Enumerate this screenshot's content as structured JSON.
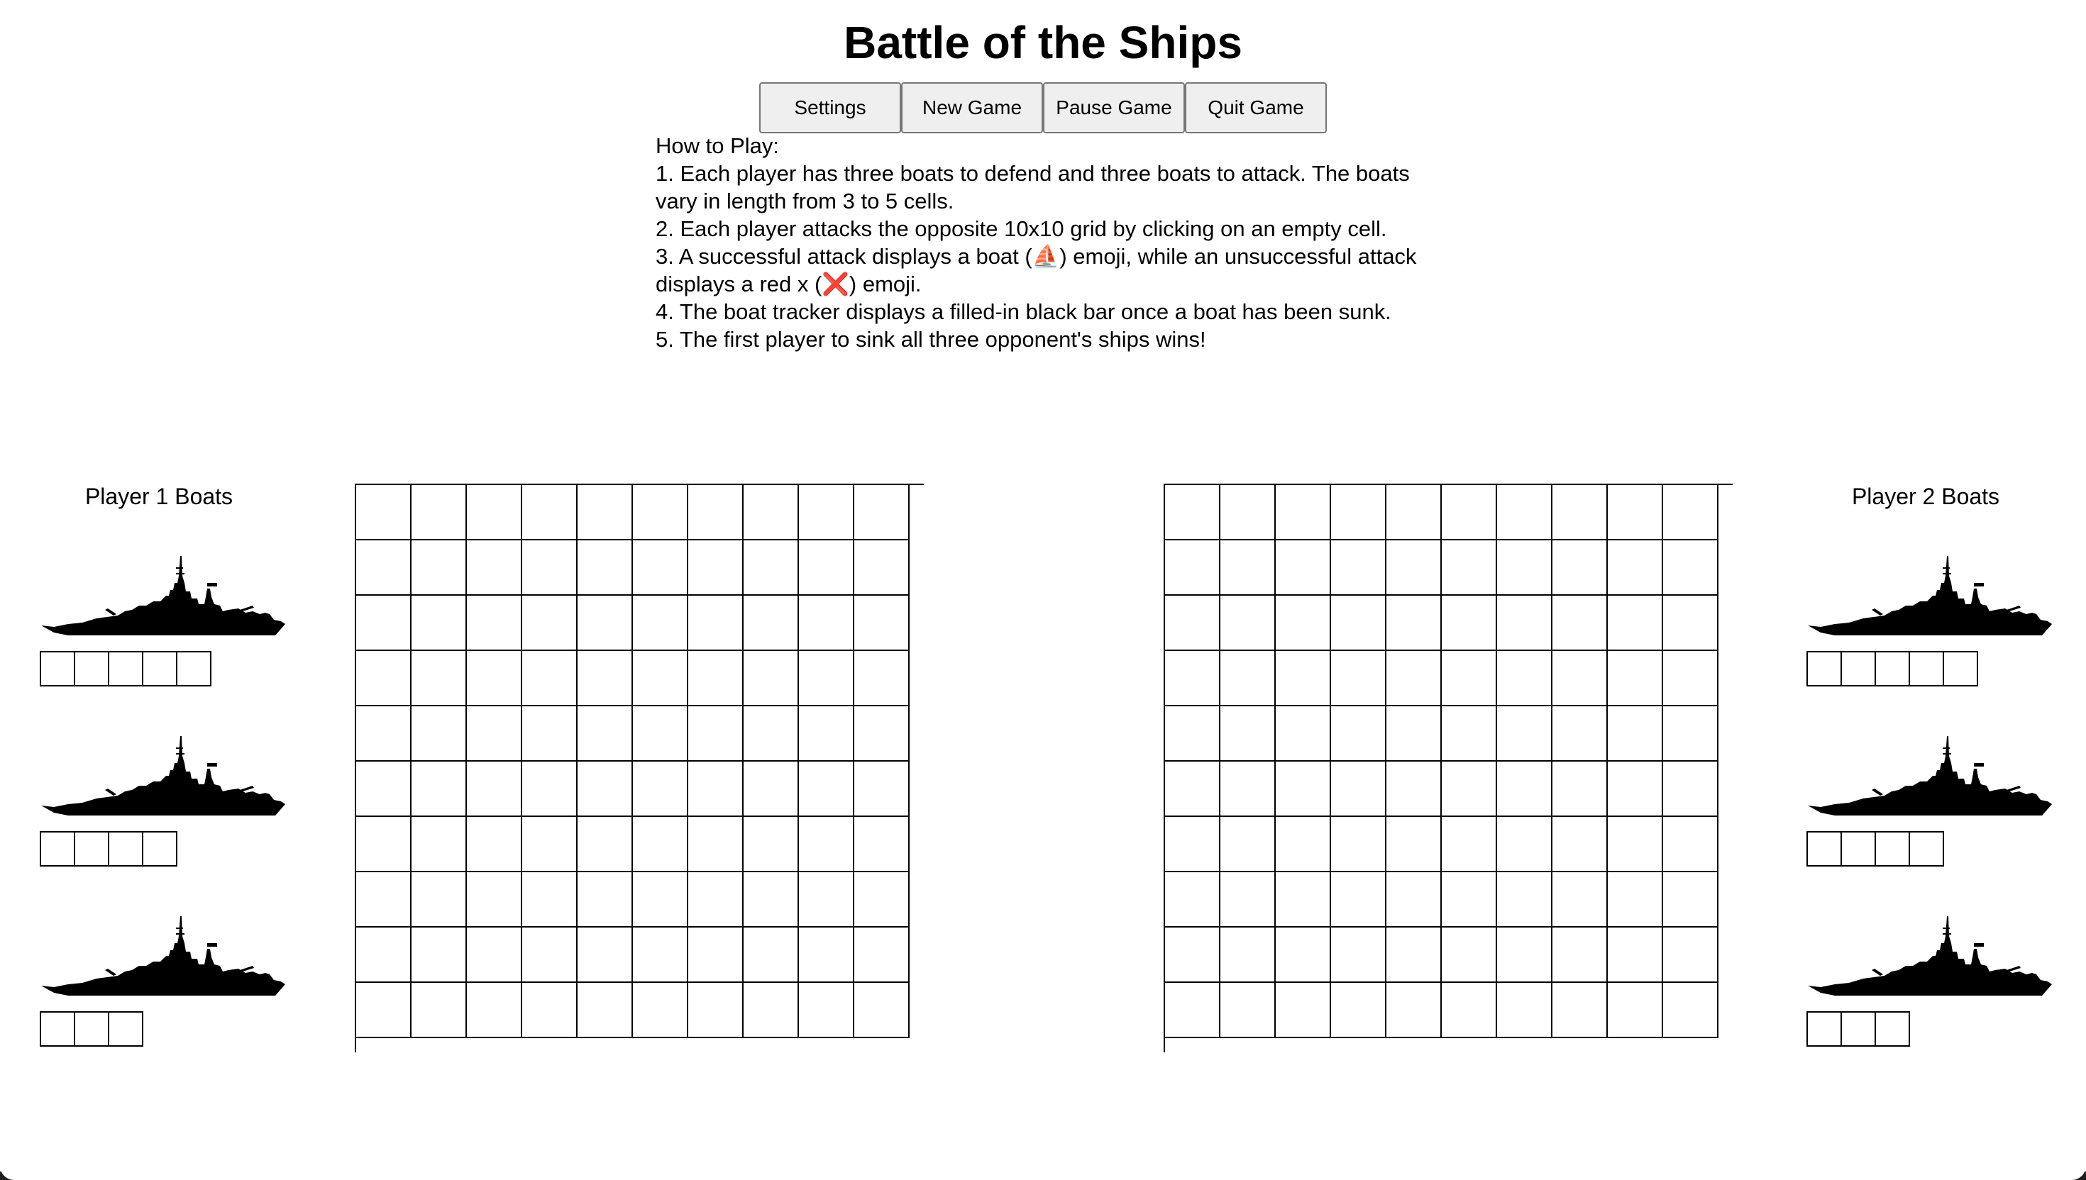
{
  "title": "Battle of the Ships",
  "toolbar": {
    "settings_label": "Settings",
    "new_game_label": "New Game",
    "pause_game_label": "Pause Game",
    "quit_game_label": "Quit Game"
  },
  "instructions": {
    "heading": "How to Play:",
    "lines": [
      "1. Each player has three boats to defend and three boats to attack. The boats vary in length from 3 to 5 cells.",
      "2. Each player attacks the opposite 10x10 grid by clicking on an empty cell.",
      "3. A successful attack displays a boat (⛵) emoji, while an unsuccessful attack displays a red x (❌) emoji.",
      "4. The boat tracker displays a filled-in black bar once a boat has been sunk.",
      "5. The first player to sink all three opponent's ships wins!"
    ]
  },
  "players": [
    {
      "label": "Player 1 Boats",
      "boats": [
        {
          "icon": "warship-icon",
          "length": 5,
          "sunk": false
        },
        {
          "icon": "warship-icon",
          "length": 4,
          "sunk": false
        },
        {
          "icon": "warship-icon",
          "length": 3,
          "sunk": false
        }
      ]
    },
    {
      "label": "Player 2 Boats",
      "boats": [
        {
          "icon": "warship-icon",
          "length": 5,
          "sunk": false
        },
        {
          "icon": "warship-icon",
          "length": 4,
          "sunk": false
        },
        {
          "icon": "warship-icon",
          "length": 3,
          "sunk": false
        }
      ]
    }
  ],
  "grids": [
    {
      "rows": 10,
      "cols": 10
    },
    {
      "rows": 10,
      "cols": 10
    }
  ],
  "colors": {
    "background": "#ffffff",
    "grid_line": "#000000",
    "button_bg": "#efefef"
  }
}
